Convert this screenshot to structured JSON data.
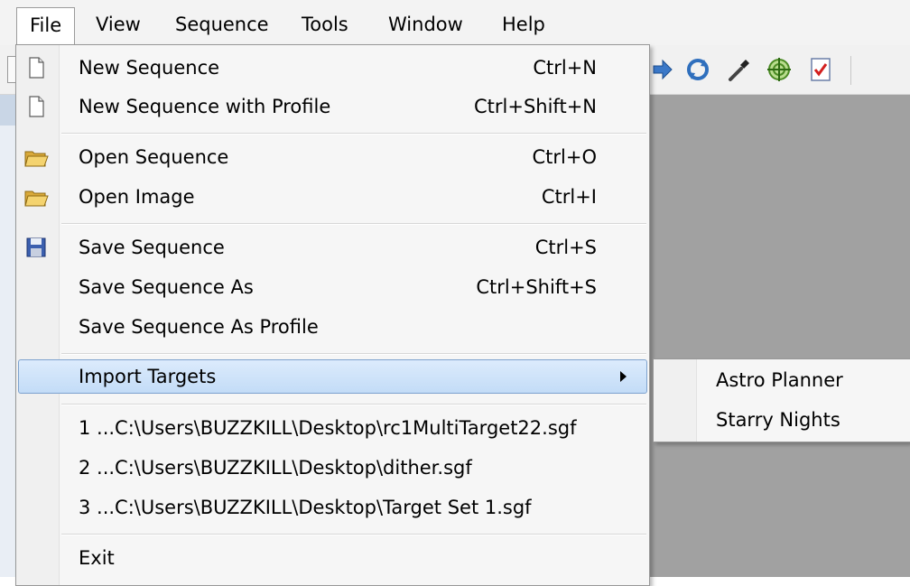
{
  "menubar": {
    "items": [
      {
        "label": "File",
        "active": true
      },
      {
        "label": "View"
      },
      {
        "label": "Sequence"
      },
      {
        "label": "Tools"
      },
      {
        "label": "Window"
      },
      {
        "label": "Help"
      }
    ]
  },
  "toolbar": {
    "icons": [
      "arrow-icon",
      "refresh-icon",
      "eyedropper-icon",
      "target-crosshair-icon",
      "checklist-icon"
    ]
  },
  "file_menu": {
    "items": [
      {
        "label": "New Sequence",
        "shortcut": "Ctrl+N",
        "icon": "new-document-icon"
      },
      {
        "label": "New Sequence with Profile",
        "shortcut": "Ctrl+Shift+N",
        "icon": "new-document-icon"
      },
      {
        "label": "Open Sequence",
        "shortcut": "Ctrl+O",
        "icon": "open-folder-icon"
      },
      {
        "label": "Open Image",
        "shortcut": "Ctrl+I",
        "icon": "open-folder-icon"
      },
      {
        "label": "Save Sequence",
        "shortcut": "Ctrl+S",
        "icon": "floppy-disk-icon"
      },
      {
        "label": "Save Sequence As",
        "shortcut": "Ctrl+Shift+S"
      },
      {
        "label": "Save Sequence As Profile",
        "shortcut": ""
      },
      {
        "label": "Import Targets",
        "shortcut": "",
        "highlighted": true,
        "has_submenu": true
      },
      {
        "label": "1 ...C:\\Users\\BUZZKILL\\Desktop\\rc1MultiTarget22.sgf",
        "shortcut": ""
      },
      {
        "label": "2 ...C:\\Users\\BUZZKILL\\Desktop\\dither.sgf",
        "shortcut": ""
      },
      {
        "label": "3 ...C:\\Users\\BUZZKILL\\Desktop\\Target Set 1.sgf",
        "shortcut": ""
      },
      {
        "label": "Exit",
        "shortcut": ""
      }
    ]
  },
  "import_submenu": {
    "items": [
      {
        "label": "Astro Planner"
      },
      {
        "label": "Starry Nights"
      }
    ]
  },
  "colors": {
    "highlight": "#c9e0f9",
    "highlight_border": "#7da2ce",
    "menu_bg": "#f6f6f6",
    "workspace_gray": "#a1a1a1"
  }
}
